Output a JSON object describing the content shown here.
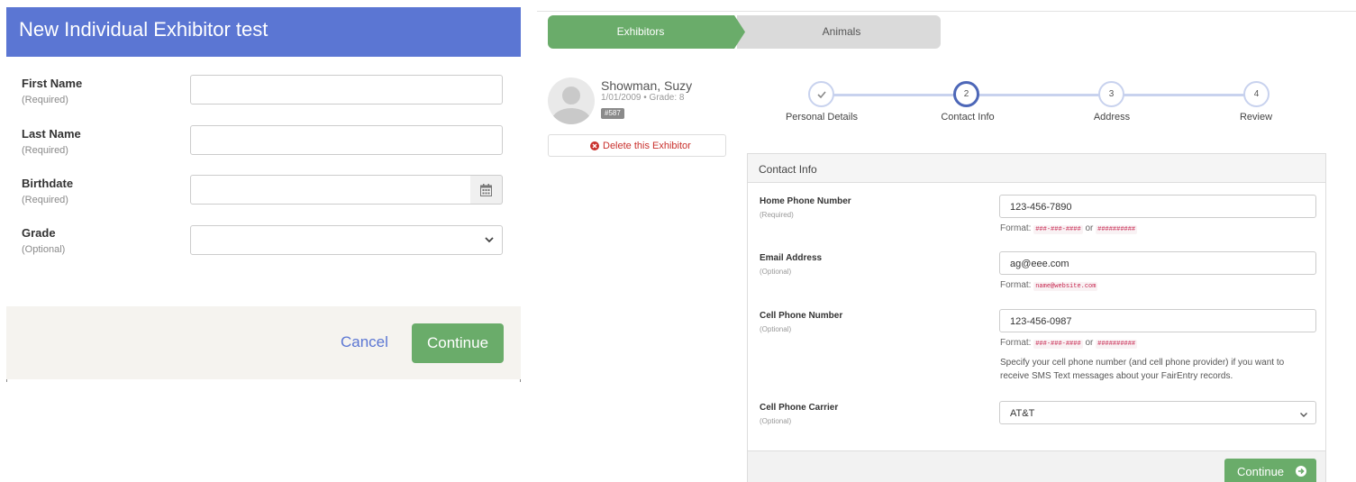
{
  "left_form": {
    "title": "New Individual Exhibitor test",
    "fields": [
      {
        "label": "First Name",
        "note": "(Required)",
        "value": ""
      },
      {
        "label": "Last Name",
        "note": "(Required)",
        "value": ""
      },
      {
        "label": "Birthdate",
        "note": "(Required)",
        "value": ""
      },
      {
        "label": "Grade",
        "note": "(Optional)",
        "value": ""
      }
    ],
    "cancel_label": "Cancel",
    "continue_label": "Continue",
    "icons": [
      "calendar-icon",
      "chevron-down-icon"
    ],
    "colors": {
      "header": "#5b76d3",
      "continue": "#6aac6a",
      "footer": "#f5f3ef"
    }
  },
  "tabs": [
    {
      "label": "Exhibitors",
      "active": true
    },
    {
      "label": "Animals",
      "active": false
    }
  ],
  "exhibitor": {
    "name": "Showman, Suzy",
    "meta": "1/01/2009 • Grade: 8",
    "id_badge": "#587",
    "delete_label": "Delete this Exhibitor"
  },
  "steps": [
    {
      "number": "",
      "label": "Personal Details",
      "state": "done"
    },
    {
      "number": "2",
      "label": "Contact Info",
      "state": "active"
    },
    {
      "number": "3",
      "label": "Address",
      "state": "todo"
    },
    {
      "number": "4",
      "label": "Review",
      "state": "todo"
    }
  ],
  "contact_info": {
    "heading": "Contact Info",
    "home_phone": {
      "label": "Home Phone Number",
      "note": "(Required)",
      "value": "123-456-7890",
      "format_prefix": "Format:",
      "format_a": "###-###-####",
      "format_or": "or",
      "format_b": "##########"
    },
    "email": {
      "label": "Email Address",
      "note": "(Optional)",
      "value": "ag@eee.com",
      "format_prefix": "Format:",
      "format_a": "name@website.com"
    },
    "cell_phone": {
      "label": "Cell Phone Number",
      "note": "(Optional)",
      "value": "123-456-0987",
      "format_prefix": "Format:",
      "format_a": "###-###-####",
      "format_or": "or",
      "format_b": "##########",
      "help": "Specify your cell phone number (and cell phone provider) if you want to receive SMS Text messages about your FairEntry records."
    },
    "carrier": {
      "label": "Cell Phone Carrier",
      "note": "(Optional)",
      "value": "AT&T"
    },
    "continue_label": "Continue"
  },
  "colors": {
    "accent": "#4d67b8",
    "success": "#6aac6a",
    "danger": "#c9302c"
  }
}
